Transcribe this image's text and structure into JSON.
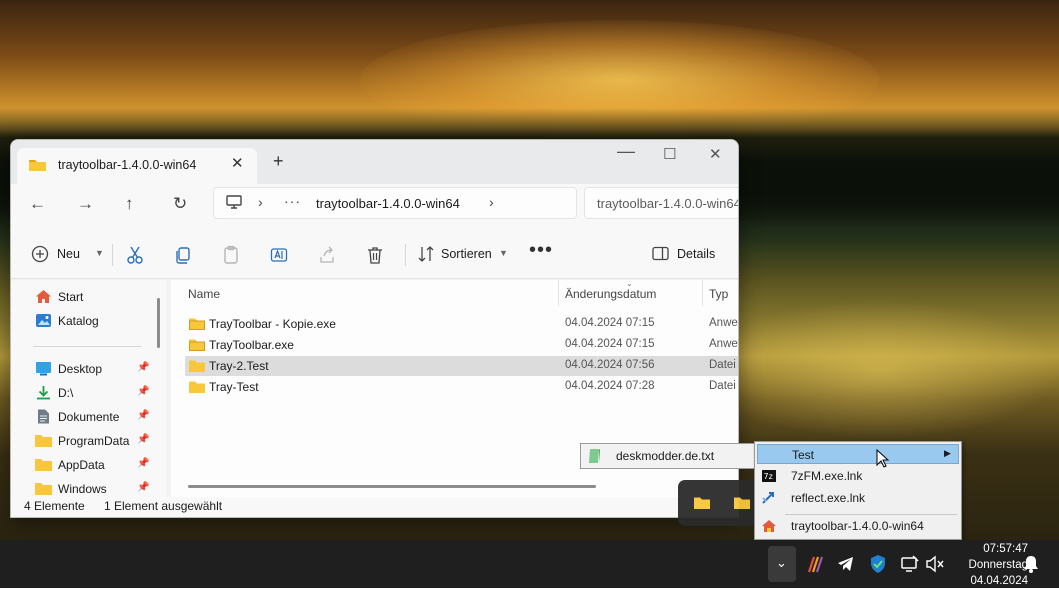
{
  "window": {
    "tab_title": "traytoolbar-1.4.0.0-win64",
    "address_crumb": "traytoolbar-1.4.0.0-win64",
    "search_placeholder": "traytoolbar-1.4.0.0-win64"
  },
  "toolbar": {
    "new_label": "Neu",
    "sort_label": "Sortieren",
    "details_label": "Details"
  },
  "nav": {
    "items": [
      {
        "label": "Start",
        "icon": "home-icon"
      },
      {
        "label": "Katalog",
        "icon": "gallery-icon"
      },
      {
        "label": "Desktop",
        "icon": "desktop-icon",
        "pinned": true
      },
      {
        "label": "D:\\",
        "icon": "download-icon",
        "pinned": true
      },
      {
        "label": "Dokumente",
        "icon": "documents-icon",
        "pinned": true
      },
      {
        "label": "ProgramData",
        "icon": "folder-icon",
        "pinned": true
      },
      {
        "label": "AppData",
        "icon": "folder-icon",
        "pinned": true
      },
      {
        "label": "Windows",
        "icon": "folder-icon",
        "pinned": true
      }
    ]
  },
  "columns": {
    "name": "Name",
    "date": "Änderungsdatum",
    "type": "Typ"
  },
  "files": [
    {
      "name": "TrayToolbar - Kopie.exe",
      "date": "04.04.2024 07:15",
      "type": "Anwe",
      "selected": false
    },
    {
      "name": "TrayToolbar.exe",
      "date": "04.04.2024 07:15",
      "type": "Anwe",
      "selected": false
    },
    {
      "name": "Tray-2.Test",
      "date": "04.04.2024 07:56",
      "type": "Datei",
      "selected": true
    },
    {
      "name": "Tray-Test",
      "date": "04.04.2024 07:28",
      "type": "Datei",
      "selected": false
    }
  ],
  "status": {
    "count": "4 Elemente",
    "selection": "1 Element ausgewählt"
  },
  "file_bar": {
    "label": "deskmodder.de.txt"
  },
  "context_menu": {
    "items": [
      {
        "label": "Test",
        "icon": "folder-icon",
        "submenu": true,
        "highlighted": true
      },
      {
        "label": "7zFM.exe.lnk",
        "icon": "7zip-icon"
      },
      {
        "label": "reflect.exe.lnk",
        "icon": "reflect-icon"
      },
      {
        "label": "traytoolbar-1.4.0.0-win64",
        "icon": "home-folder-icon"
      }
    ]
  },
  "clock": {
    "time": "07:57:47",
    "day": "Donnerstag",
    "date": "04.04.2024"
  },
  "colors": {
    "accent": "#99c9ef",
    "folder": "#f8c73a",
    "taskbar": "#1f1f1f"
  }
}
